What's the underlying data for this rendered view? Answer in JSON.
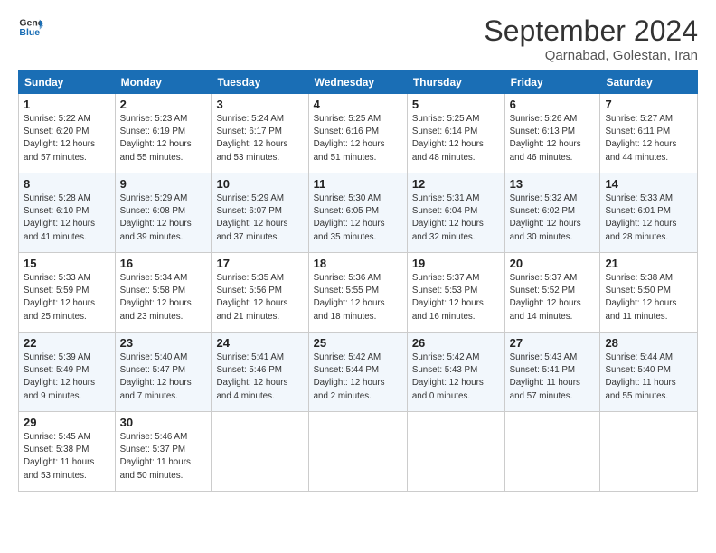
{
  "header": {
    "logo_line1": "General",
    "logo_line2": "Blue",
    "month_title": "September 2024",
    "subtitle": "Qarnabad, Golestan, Iran"
  },
  "weekdays": [
    "Sunday",
    "Monday",
    "Tuesday",
    "Wednesday",
    "Thursday",
    "Friday",
    "Saturday"
  ],
  "weeks": [
    [
      {
        "day": "1",
        "info": "Sunrise: 5:22 AM\nSunset: 6:20 PM\nDaylight: 12 hours\nand 57 minutes."
      },
      {
        "day": "2",
        "info": "Sunrise: 5:23 AM\nSunset: 6:19 PM\nDaylight: 12 hours\nand 55 minutes."
      },
      {
        "day": "3",
        "info": "Sunrise: 5:24 AM\nSunset: 6:17 PM\nDaylight: 12 hours\nand 53 minutes."
      },
      {
        "day": "4",
        "info": "Sunrise: 5:25 AM\nSunset: 6:16 PM\nDaylight: 12 hours\nand 51 minutes."
      },
      {
        "day": "5",
        "info": "Sunrise: 5:25 AM\nSunset: 6:14 PM\nDaylight: 12 hours\nand 48 minutes."
      },
      {
        "day": "6",
        "info": "Sunrise: 5:26 AM\nSunset: 6:13 PM\nDaylight: 12 hours\nand 46 minutes."
      },
      {
        "day": "7",
        "info": "Sunrise: 5:27 AM\nSunset: 6:11 PM\nDaylight: 12 hours\nand 44 minutes."
      }
    ],
    [
      {
        "day": "8",
        "info": "Sunrise: 5:28 AM\nSunset: 6:10 PM\nDaylight: 12 hours\nand 41 minutes."
      },
      {
        "day": "9",
        "info": "Sunrise: 5:29 AM\nSunset: 6:08 PM\nDaylight: 12 hours\nand 39 minutes."
      },
      {
        "day": "10",
        "info": "Sunrise: 5:29 AM\nSunset: 6:07 PM\nDaylight: 12 hours\nand 37 minutes."
      },
      {
        "day": "11",
        "info": "Sunrise: 5:30 AM\nSunset: 6:05 PM\nDaylight: 12 hours\nand 35 minutes."
      },
      {
        "day": "12",
        "info": "Sunrise: 5:31 AM\nSunset: 6:04 PM\nDaylight: 12 hours\nand 32 minutes."
      },
      {
        "day": "13",
        "info": "Sunrise: 5:32 AM\nSunset: 6:02 PM\nDaylight: 12 hours\nand 30 minutes."
      },
      {
        "day": "14",
        "info": "Sunrise: 5:33 AM\nSunset: 6:01 PM\nDaylight: 12 hours\nand 28 minutes."
      }
    ],
    [
      {
        "day": "15",
        "info": "Sunrise: 5:33 AM\nSunset: 5:59 PM\nDaylight: 12 hours\nand 25 minutes."
      },
      {
        "day": "16",
        "info": "Sunrise: 5:34 AM\nSunset: 5:58 PM\nDaylight: 12 hours\nand 23 minutes."
      },
      {
        "day": "17",
        "info": "Sunrise: 5:35 AM\nSunset: 5:56 PM\nDaylight: 12 hours\nand 21 minutes."
      },
      {
        "day": "18",
        "info": "Sunrise: 5:36 AM\nSunset: 5:55 PM\nDaylight: 12 hours\nand 18 minutes."
      },
      {
        "day": "19",
        "info": "Sunrise: 5:37 AM\nSunset: 5:53 PM\nDaylight: 12 hours\nand 16 minutes."
      },
      {
        "day": "20",
        "info": "Sunrise: 5:37 AM\nSunset: 5:52 PM\nDaylight: 12 hours\nand 14 minutes."
      },
      {
        "day": "21",
        "info": "Sunrise: 5:38 AM\nSunset: 5:50 PM\nDaylight: 12 hours\nand 11 minutes."
      }
    ],
    [
      {
        "day": "22",
        "info": "Sunrise: 5:39 AM\nSunset: 5:49 PM\nDaylight: 12 hours\nand 9 minutes."
      },
      {
        "day": "23",
        "info": "Sunrise: 5:40 AM\nSunset: 5:47 PM\nDaylight: 12 hours\nand 7 minutes."
      },
      {
        "day": "24",
        "info": "Sunrise: 5:41 AM\nSunset: 5:46 PM\nDaylight: 12 hours\nand 4 minutes."
      },
      {
        "day": "25",
        "info": "Sunrise: 5:42 AM\nSunset: 5:44 PM\nDaylight: 12 hours\nand 2 minutes."
      },
      {
        "day": "26",
        "info": "Sunrise: 5:42 AM\nSunset: 5:43 PM\nDaylight: 12 hours\nand 0 minutes."
      },
      {
        "day": "27",
        "info": "Sunrise: 5:43 AM\nSunset: 5:41 PM\nDaylight: 11 hours\nand 57 minutes."
      },
      {
        "day": "28",
        "info": "Sunrise: 5:44 AM\nSunset: 5:40 PM\nDaylight: 11 hours\nand 55 minutes."
      }
    ],
    [
      {
        "day": "29",
        "info": "Sunrise: 5:45 AM\nSunset: 5:38 PM\nDaylight: 11 hours\nand 53 minutes."
      },
      {
        "day": "30",
        "info": "Sunrise: 5:46 AM\nSunset: 5:37 PM\nDaylight: 11 hours\nand 50 minutes."
      },
      {
        "day": "",
        "info": ""
      },
      {
        "day": "",
        "info": ""
      },
      {
        "day": "",
        "info": ""
      },
      {
        "day": "",
        "info": ""
      },
      {
        "day": "",
        "info": ""
      }
    ]
  ]
}
